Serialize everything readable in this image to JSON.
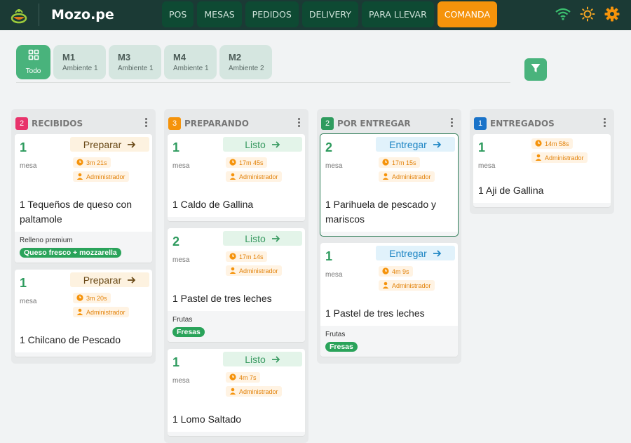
{
  "header": {
    "brand": "Mozo.pe",
    "tabs": [
      {
        "label": "POS",
        "active": false
      },
      {
        "label": "MESAS",
        "active": false
      },
      {
        "label": "PEDIDOS",
        "active": false
      },
      {
        "label": "DELIVERY",
        "active": false
      },
      {
        "label": "PARA LLEVAR",
        "active": false
      },
      {
        "label": "COMANDA",
        "active": true
      }
    ],
    "icons": [
      "wifi-icon",
      "brightness-icon",
      "settings-icon"
    ]
  },
  "filters": {
    "chips": [
      {
        "code": "",
        "sub": "Todo",
        "icon": "grid-icon",
        "active": true
      },
      {
        "code": "M1",
        "sub": "Ambiente 1",
        "active": false
      },
      {
        "code": "M3",
        "sub": "Ambiente 1",
        "active": false
      },
      {
        "code": "M4",
        "sub": "Ambiente 1",
        "active": false
      },
      {
        "code": "M2",
        "sub": "Ambiente 2",
        "active": false
      }
    ],
    "filter_icon": "filter-icon"
  },
  "colors": {
    "recibidos": "#e8336b",
    "preparando": "#f5930b",
    "por_entregar": "#2e9b5e",
    "entregados": "#1a73c9",
    "accent": "#49b37c",
    "header": "#1b3a35"
  },
  "columns": [
    {
      "count": "2",
      "title": "RECIBIDOS",
      "cards": [
        {
          "qty": "1",
          "mesa": "mesa",
          "action": "Preparar",
          "time": "3m 21s",
          "user": "Administrador",
          "dish": "1 Tequeños de queso con paltamole",
          "extra_label": "Relleno premium",
          "extra_pill": "Queso fresco + mozzarella"
        },
        {
          "qty": "1",
          "mesa": "mesa",
          "action": "Preparar",
          "time": "3m 20s",
          "user": "Administrador",
          "dish": "1 Chilcano de Pescado"
        }
      ]
    },
    {
      "count": "3",
      "title": "PREPARANDO",
      "cards": [
        {
          "qty": "1",
          "mesa": "mesa",
          "action": "Listo",
          "time": "17m 45s",
          "user": "Administrador",
          "dish": "1 Caldo de Gallina"
        },
        {
          "qty": "2",
          "mesa": "mesa",
          "action": "Listo",
          "time": "17m 14s",
          "user": "Administrador",
          "dish": "1 Pastel de tres leches",
          "extra_label": "Frutas",
          "extra_pill": "Fresas"
        },
        {
          "qty": "1",
          "mesa": "mesa",
          "action": "Listo",
          "time": "4m 7s",
          "user": "Administrador",
          "dish": "1 Lomo Saltado"
        }
      ]
    },
    {
      "count": "2",
      "title": "POR ENTREGAR",
      "cards": [
        {
          "qty": "2",
          "mesa": "mesa",
          "action": "Entregar",
          "time": "17m 15s",
          "user": "Administrador",
          "dish": "1 Parihuela de pescado y mariscos"
        },
        {
          "qty": "1",
          "mesa": "mesa",
          "action": "Entregar",
          "time": "4m 9s",
          "user": "Administrador",
          "dish": "1 Pastel de tres leches",
          "extra_label": "Frutas",
          "extra_pill": "Fresas"
        }
      ]
    },
    {
      "count": "1",
      "title": "ENTREGADOS",
      "cards": [
        {
          "qty": "1",
          "mesa": "mesa",
          "time": "14m 58s",
          "user": "Administrador",
          "dish": "1 Aji de Gallina"
        }
      ]
    }
  ]
}
